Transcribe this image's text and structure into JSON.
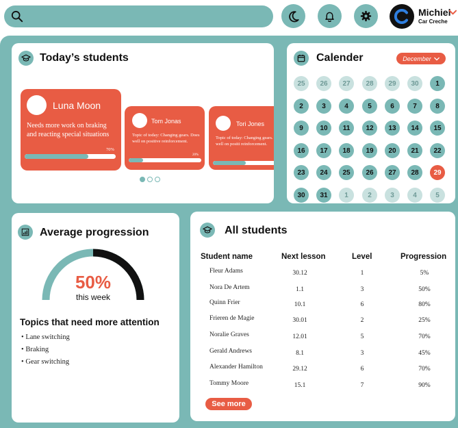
{
  "topbar": {
    "search_placeholder": "",
    "user_name": "Michiel",
    "user_subtitle": "Car Creche"
  },
  "today_students": {
    "title": "Today’s students",
    "cards": [
      {
        "name": "Luna Moon",
        "note": "Needs more work on braking and reacting special situations",
        "progress_label": "70%",
        "progress": 0.7
      },
      {
        "name": "Tom Jonas",
        "note": "Topic of today: Changing gears. Does well on positive reinforcement.",
        "progress_label": "20%",
        "progress": 0.2
      },
      {
        "name": "Tori Jones",
        "note": "Topic of today: Changing gears. Does well on positi reinforcement.",
        "progress_label": "",
        "progress": 0.45
      }
    ],
    "pager": {
      "count": 3,
      "active": 0
    }
  },
  "calendar": {
    "title": "Calender",
    "month": "December",
    "days": [
      [
        "25",
        "other"
      ],
      [
        "26",
        "other"
      ],
      [
        "27",
        "other"
      ],
      [
        "28",
        "other"
      ],
      [
        "29",
        "other"
      ],
      [
        "30",
        "other"
      ],
      [
        "1",
        "cur"
      ],
      [
        "2",
        "cur"
      ],
      [
        "3",
        "cur"
      ],
      [
        "4",
        "cur"
      ],
      [
        "5",
        "cur"
      ],
      [
        "6",
        "cur"
      ],
      [
        "7",
        "cur"
      ],
      [
        "8",
        "cur"
      ],
      [
        "9",
        "cur"
      ],
      [
        "10",
        "cur"
      ],
      [
        "11",
        "cur"
      ],
      [
        "12",
        "cur"
      ],
      [
        "13",
        "cur"
      ],
      [
        "14",
        "cur"
      ],
      [
        "15",
        "cur"
      ],
      [
        "16",
        "cur"
      ],
      [
        "17",
        "cur"
      ],
      [
        "18",
        "cur"
      ],
      [
        "19",
        "cur"
      ],
      [
        "20",
        "cur"
      ],
      [
        "21",
        "cur"
      ],
      [
        "22",
        "cur"
      ],
      [
        "23",
        "cur"
      ],
      [
        "24",
        "cur"
      ],
      [
        "25",
        "cur"
      ],
      [
        "26",
        "cur"
      ],
      [
        "27",
        "cur"
      ],
      [
        "28",
        "cur"
      ],
      [
        "29",
        "today"
      ],
      [
        "30",
        "cur"
      ],
      [
        "31",
        "cur"
      ],
      [
        "1",
        "other"
      ],
      [
        "2",
        "other"
      ],
      [
        "3",
        "other"
      ],
      [
        "4",
        "other"
      ],
      [
        "5",
        "other"
      ]
    ]
  },
  "average": {
    "title": "Average progression",
    "value": 0.5,
    "value_label": "50%",
    "period": "this week",
    "topics_title": "Topics that need more attention",
    "topics": [
      "Lane switching",
      "Braking",
      "Gear switching"
    ]
  },
  "all_students": {
    "title": "All students",
    "headers": [
      "Student name",
      "Next lesson",
      "Level",
      "Progression"
    ],
    "rows": [
      [
        "Fleur Adams",
        "30.12",
        "1",
        "5%"
      ],
      [
        "Nora De Artem",
        "1.1",
        "3",
        "50%"
      ],
      [
        "Quinn Frier",
        "10.1",
        "6",
        "80%"
      ],
      [
        "Frieren de Magie",
        "30.01",
        "2",
        "25%"
      ],
      [
        "Noralie Graves",
        "12.01",
        "5",
        "70%"
      ],
      [
        "Gerald Andrews",
        "8.1",
        "3",
        "45%"
      ],
      [
        "Alexander Hamilton",
        "29.12",
        "6",
        "70%"
      ],
      [
        "Tommy Moore",
        "15.1",
        "7",
        "90%"
      ]
    ],
    "see_more": "See more"
  },
  "colors": {
    "teal": "#7ab8b5",
    "accent": "#e85c44",
    "dark": "#111111"
  }
}
